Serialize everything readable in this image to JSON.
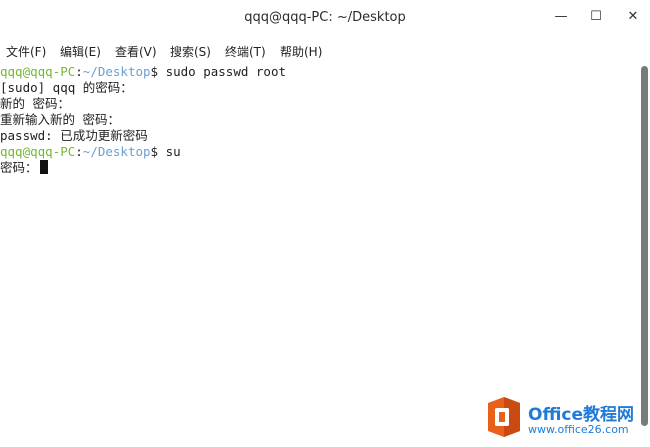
{
  "window": {
    "title": "qqq@qqq-PC: ~/Desktop",
    "minimize_icon": "—",
    "maximize_icon": "☐",
    "close_icon": "✕"
  },
  "menu": {
    "items": [
      {
        "label": "文件(F)"
      },
      {
        "label": "编辑(E)"
      },
      {
        "label": "查看(V)"
      },
      {
        "label": "搜索(S)"
      },
      {
        "label": "终端(T)"
      },
      {
        "label": "帮助(H)"
      }
    ]
  },
  "terminal": {
    "prompt": {
      "user": "qqq@qqq-PC",
      "sep": ":",
      "path": "~/Desktop",
      "sign": "$"
    },
    "lines": [
      {
        "type": "prompt",
        "command": " sudo passwd root"
      },
      {
        "type": "output",
        "text": "[sudo] qqq 的密码："
      },
      {
        "type": "output",
        "text": "新的 密码："
      },
      {
        "type": "output",
        "text": "重新输入新的 密码："
      },
      {
        "type": "output",
        "text": "passwd: 已成功更新密码"
      },
      {
        "type": "prompt",
        "command": " su"
      },
      {
        "type": "output",
        "text": "密码："
      }
    ]
  },
  "watermark": {
    "title": "Office教程网",
    "url": "www.office26.com",
    "logo_icon": "office-logo-icon",
    "colors": {
      "orange": "#e8611a",
      "blue": "#1f7bd6"
    }
  }
}
